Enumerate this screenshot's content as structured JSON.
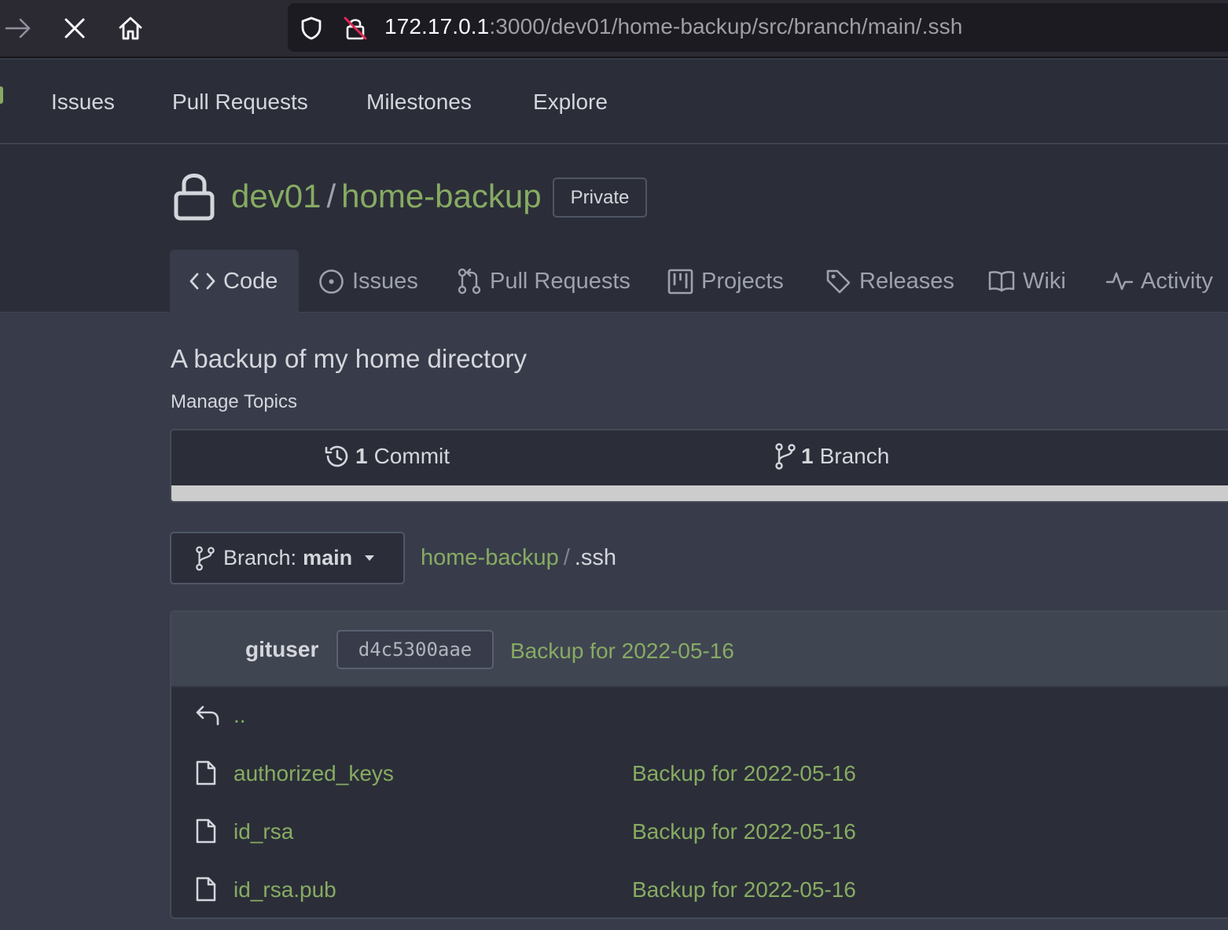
{
  "browser": {
    "url_host": "172.17.0.1",
    "url_rest": ":3000/dev01/home-backup/src/branch/main/.ssh",
    "icons": [
      "forward-icon",
      "stop-icon",
      "home-icon",
      "shield-icon",
      "insecure-lock-icon"
    ]
  },
  "topnav": {
    "links": [
      "Issues",
      "Pull Requests",
      "Milestones",
      "Explore"
    ]
  },
  "repo": {
    "owner": "dev01",
    "separator": "/",
    "name": "home-backup",
    "visibility": "Private",
    "description": "A backup of my home directory",
    "manage_topics": "Manage Topics"
  },
  "tabs": [
    {
      "label": "Code",
      "icon": "code-icon",
      "active": true
    },
    {
      "label": "Issues",
      "icon": "issue-icon"
    },
    {
      "label": "Pull Requests",
      "icon": "pull-request-icon"
    },
    {
      "label": "Projects",
      "icon": "project-icon"
    },
    {
      "label": "Releases",
      "icon": "tag-icon"
    },
    {
      "label": "Wiki",
      "icon": "book-icon"
    },
    {
      "label": "Activity",
      "icon": "pulse-icon"
    }
  ],
  "stats": {
    "commits_count": "1",
    "commits_label": "Commit",
    "branches_count": "1",
    "branches_label": "Branch"
  },
  "branch": {
    "prefix": "Branch:",
    "name": "main"
  },
  "breadcrumb": {
    "root": "home-backup",
    "separator": "/",
    "current": ".ssh"
  },
  "latest_commit": {
    "author": "gituser",
    "sha": "d4c5300aae",
    "message": "Backup for 2022-05-16"
  },
  "files": {
    "parent": "..",
    "rows": [
      {
        "name": "authorized_keys",
        "commit": "Backup for 2022-05-16"
      },
      {
        "name": "id_rsa",
        "commit": "Backup for 2022-05-16"
      },
      {
        "name": "id_rsa.pub",
        "commit": "Backup for 2022-05-16"
      }
    ]
  },
  "colors": {
    "accent": "#87ab63",
    "background": "#383c4a",
    "header": "#2b2e38"
  }
}
